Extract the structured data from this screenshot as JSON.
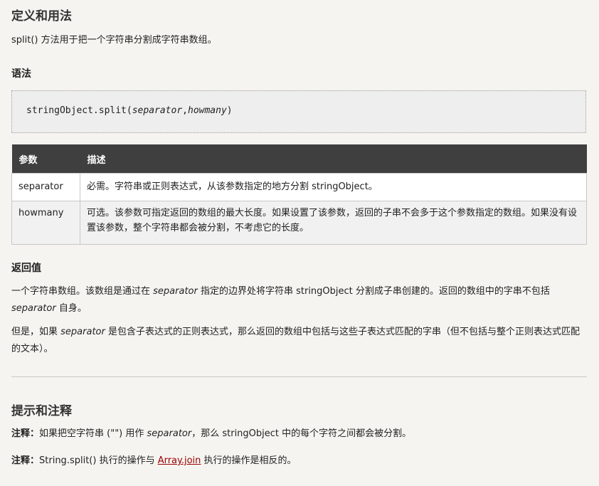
{
  "definition": {
    "title": "定义和用法",
    "text": "split() 方法用于把一个字符串分割成字符串数组。"
  },
  "syntax": {
    "title": "语法",
    "code_prefix": "stringObject.split(",
    "code_arg1": "separator",
    "code_comma": ",",
    "code_arg2": "howmany",
    "code_suffix": ")"
  },
  "params_table": {
    "headers": [
      "参数",
      "描述"
    ],
    "rows": [
      {
        "name": "separator",
        "desc": "必需。字符串或正则表达式，从该参数指定的地方分割 stringObject。"
      },
      {
        "name": "howmany",
        "desc": "可选。该参数可指定返回的数组的最大长度。如果设置了该参数，返回的子串不会多于这个参数指定的数组。如果没有设置该参数，整个字符串都会被分割，不考虑它的长度。"
      }
    ]
  },
  "return_value": {
    "title": "返回值",
    "p1_a": "一个字符串数组。该数组是通过在 ",
    "p1_em": "separator",
    "p1_b": " 指定的边界处将字符串 stringObject 分割成子串创建的。返回的数组中的字串不包括 ",
    "p1_em2": "separator",
    "p1_c": " 自身。",
    "p2_a": "但是，如果 ",
    "p2_em": "separator",
    "p2_b": " 是包含子表达式的正则表达式，那么返回的数组中包括与这些子表达式匹配的字串（但不包括与整个正则表达式匹配的文本）。"
  },
  "tips": {
    "title": "提示和注释",
    "note_label": "注释：",
    "note1_a": "如果把空字符串 (\"\") 用作 ",
    "note1_em": "separator",
    "note1_b": "，那么 stringObject 中的每个字符之间都会被分割。",
    "note2_a": "String.split() 执行的操作与 ",
    "note2_link": "Array.join",
    "note2_b": " 执行的操作是相反的。"
  }
}
